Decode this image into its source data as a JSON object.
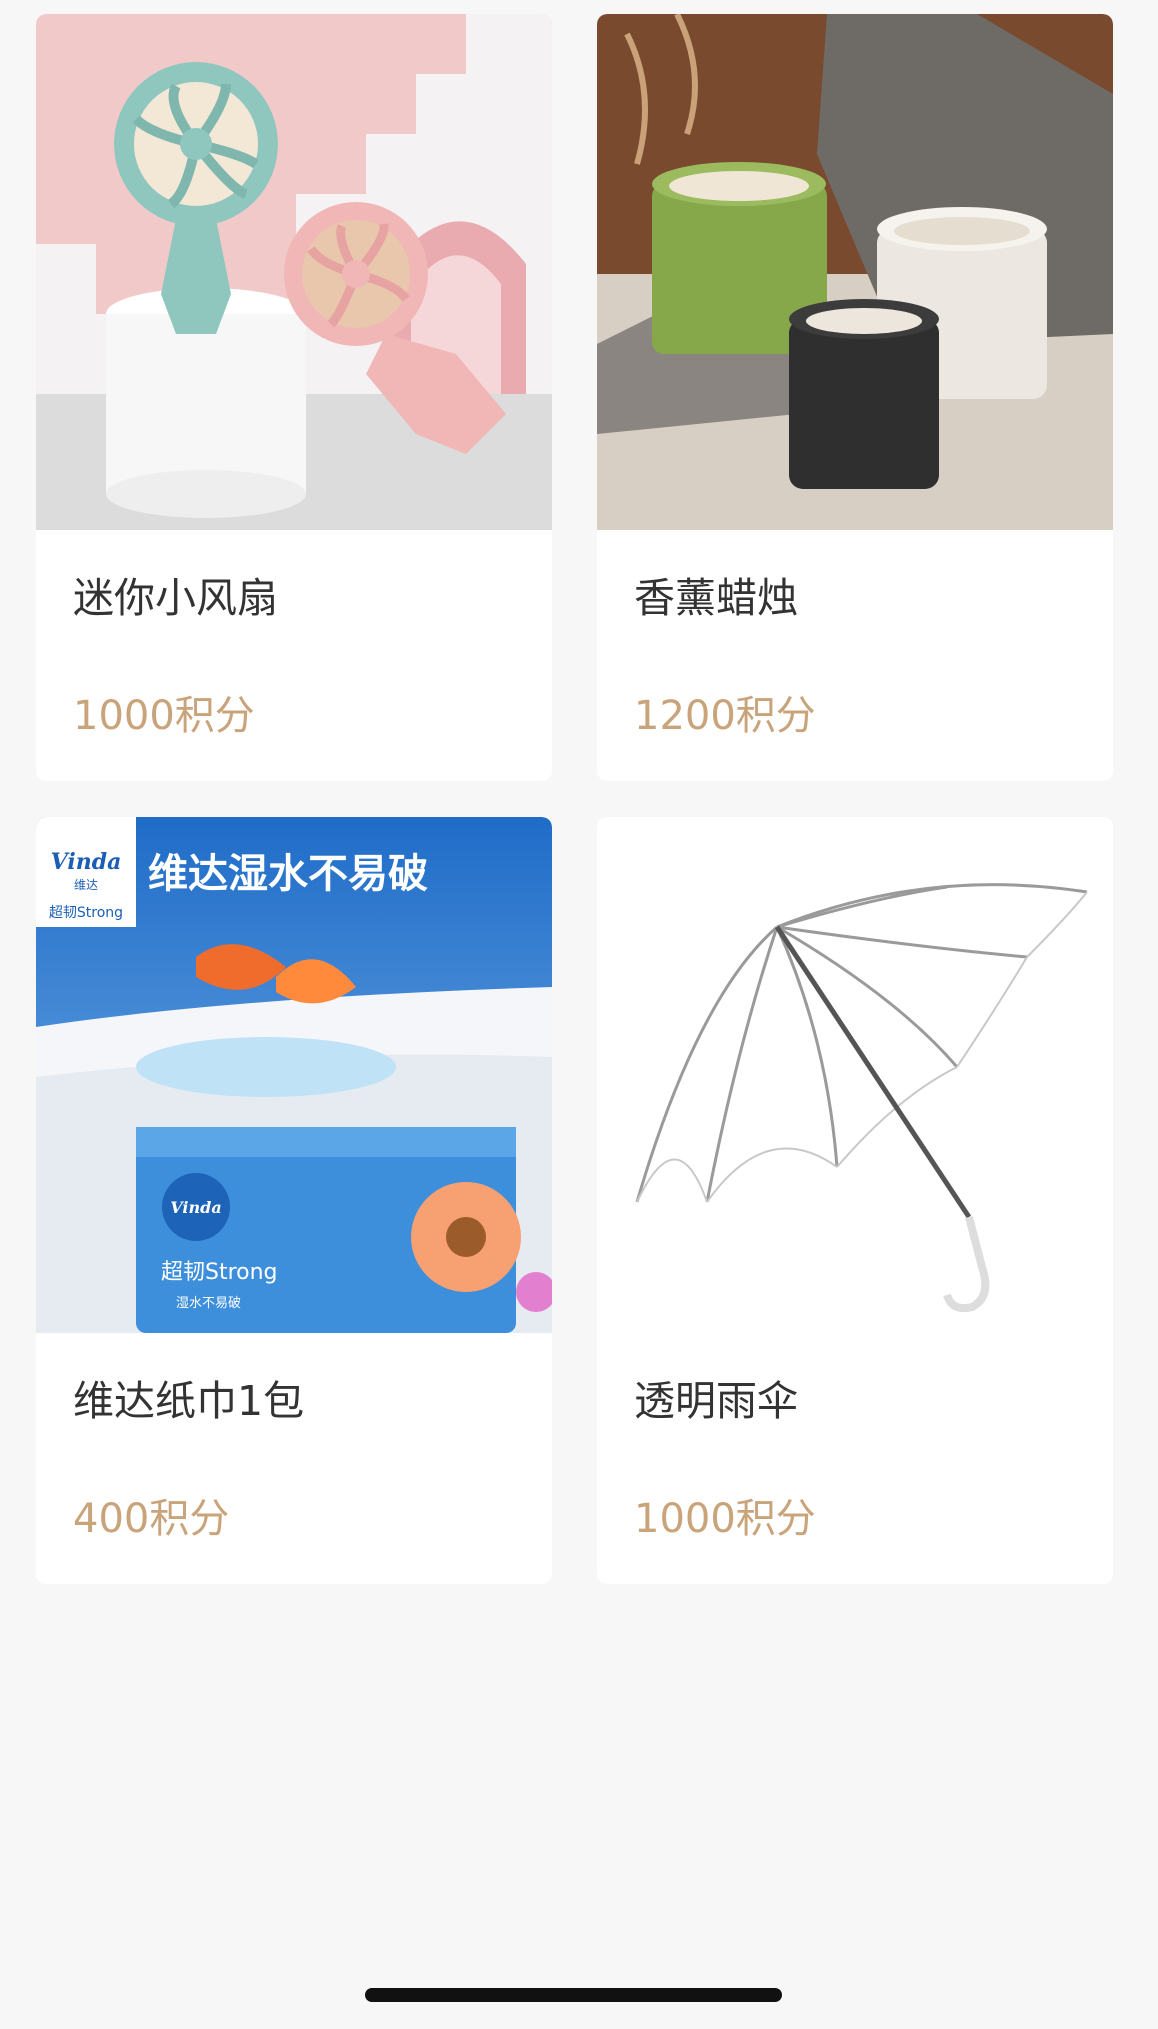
{
  "products": [
    {
      "name": "迷你小风扇",
      "price": "1000积分"
    },
    {
      "name": "香薰蜡烛",
      "price": "1200积分"
    },
    {
      "name": "维达纸巾1包",
      "price": "400积分",
      "image_text": {
        "brand": "Vinda",
        "brand_cn": "维达",
        "slogan": "维达湿水不易破",
        "pack_line": "超韧Strong",
        "pack_sub": "湿水不易破"
      }
    },
    {
      "name": "透明雨伞",
      "price": "1000积分"
    }
  ],
  "colors": {
    "background": "#f7f7f7",
    "card": "#ffffff",
    "name_text": "#333333",
    "price_text": "#c9a47a"
  }
}
